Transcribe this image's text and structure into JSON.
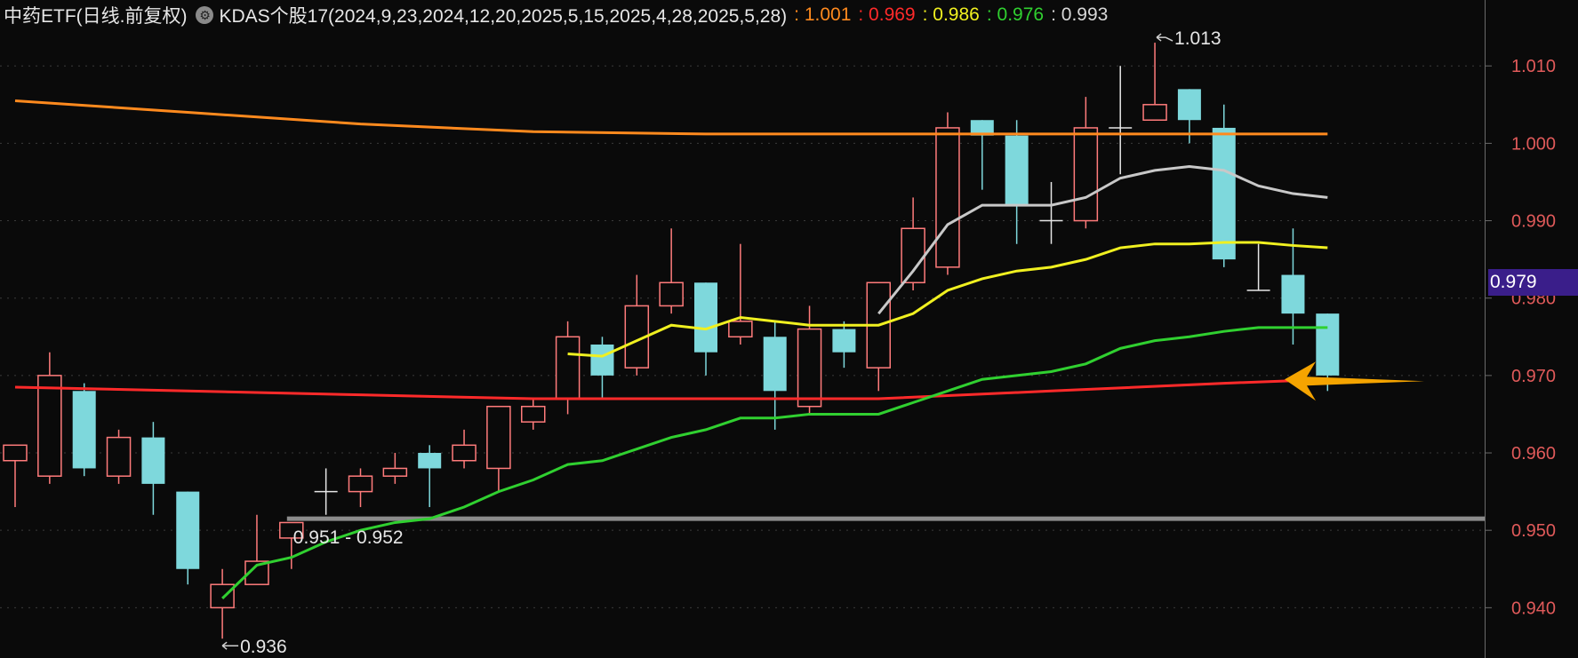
{
  "header": {
    "title": "中药ETF(日线.前复权)",
    "indicator": "KDAS个股17(2024,9,23,2024,12,20,2025,5,15,2025,4,28,2025,5,28)",
    "values": [
      {
        "text": ": 1.001",
        "color": "#ff8a1e"
      },
      {
        "text": ": 0.969",
        "color": "#ff2a2a"
      },
      {
        "text": ": 0.986",
        "color": "#f0f020"
      },
      {
        "text": ": 0.976",
        "color": "#30d030"
      },
      {
        "text": ": 0.993",
        "color": "#d8d8d8"
      }
    ]
  },
  "last_price": "0.979",
  "annotations": {
    "high_label": "1.013",
    "low_label": "0.936",
    "range_label": "0.951 - 0.952"
  },
  "colors": {
    "up": "#ff7b7b",
    "down": "#7ed8dc",
    "doji": "#e6e6e6",
    "arrow": "#f5a400",
    "level_line": "#8c8c8c"
  },
  "chart_data": {
    "type": "candlestick",
    "ylim": [
      0.9335,
      1.0145
    ],
    "ticks": [
      "1.010",
      "1.000",
      "0.990",
      "0.980",
      "0.970",
      "0.960",
      "0.950",
      "0.940"
    ],
    "tick_values": [
      1.01,
      1.0,
      0.99,
      0.98,
      0.97,
      0.96,
      0.95,
      0.94
    ],
    "grid": true,
    "candles": [
      {
        "o": 0.959,
        "h": 0.961,
        "l": 0.953,
        "c": 0.961
      },
      {
        "o": 0.957,
        "h": 0.973,
        "l": 0.956,
        "c": 0.97
      },
      {
        "o": 0.968,
        "h": 0.969,
        "l": 0.957,
        "c": 0.958
      },
      {
        "o": 0.957,
        "h": 0.963,
        "l": 0.956,
        "c": 0.962
      },
      {
        "o": 0.962,
        "h": 0.964,
        "l": 0.952,
        "c": 0.956
      },
      {
        "o": 0.955,
        "h": 0.955,
        "l": 0.943,
        "c": 0.945
      },
      {
        "o": 0.94,
        "h": 0.945,
        "l": 0.936,
        "c": 0.943
      },
      {
        "o": 0.943,
        "h": 0.952,
        "l": 0.943,
        "c": 0.946
      },
      {
        "o": 0.949,
        "h": 0.951,
        "l": 0.945,
        "c": 0.951
      },
      {
        "o": 0.955,
        "h": 0.958,
        "l": 0.952,
        "c": 0.955
      },
      {
        "o": 0.955,
        "h": 0.958,
        "l": 0.953,
        "c": 0.957
      },
      {
        "o": 0.957,
        "h": 0.96,
        "l": 0.956,
        "c": 0.958
      },
      {
        "o": 0.96,
        "h": 0.961,
        "l": 0.953,
        "c": 0.958
      },
      {
        "o": 0.959,
        "h": 0.963,
        "l": 0.958,
        "c": 0.961
      },
      {
        "o": 0.958,
        "h": 0.966,
        "l": 0.955,
        "c": 0.966
      },
      {
        "o": 0.964,
        "h": 0.967,
        "l": 0.963,
        "c": 0.966
      },
      {
        "o": 0.967,
        "h": 0.977,
        "l": 0.965,
        "c": 0.975
      },
      {
        "o": 0.974,
        "h": 0.975,
        "l": 0.967,
        "c": 0.97
      },
      {
        "o": 0.971,
        "h": 0.983,
        "l": 0.97,
        "c": 0.979
      },
      {
        "o": 0.979,
        "h": 0.989,
        "l": 0.978,
        "c": 0.982
      },
      {
        "o": 0.982,
        "h": 0.982,
        "l": 0.97,
        "c": 0.973
      },
      {
        "o": 0.975,
        "h": 0.987,
        "l": 0.974,
        "c": 0.977
      },
      {
        "o": 0.975,
        "h": 0.977,
        "l": 0.963,
        "c": 0.968
      },
      {
        "o": 0.966,
        "h": 0.979,
        "l": 0.965,
        "c": 0.976
      },
      {
        "o": 0.976,
        "h": 0.977,
        "l": 0.971,
        "c": 0.973
      },
      {
        "o": 0.971,
        "h": 0.982,
        "l": 0.968,
        "c": 0.982
      },
      {
        "o": 0.982,
        "h": 0.993,
        "l": 0.981,
        "c": 0.989
      },
      {
        "o": 0.984,
        "h": 1.004,
        "l": 0.983,
        "c": 1.002
      },
      {
        "o": 1.003,
        "h": 1.003,
        "l": 0.994,
        "c": 1.001
      },
      {
        "o": 1.001,
        "h": 1.003,
        "l": 0.987,
        "c": 0.992
      },
      {
        "o": 0.99,
        "h": 0.995,
        "l": 0.987,
        "c": 0.99
      },
      {
        "o": 0.99,
        "h": 1.006,
        "l": 0.989,
        "c": 1.002
      },
      {
        "o": 1.002,
        "h": 1.01,
        "l": 0.996,
        "c": 1.002
      },
      {
        "o": 1.003,
        "h": 1.013,
        "l": 1.003,
        "c": 1.005
      },
      {
        "o": 1.007,
        "h": 1.007,
        "l": 1.0,
        "c": 1.003
      },
      {
        "o": 1.002,
        "h": 1.005,
        "l": 0.984,
        "c": 0.985
      },
      {
        "o": 0.981,
        "h": 0.987,
        "l": 0.981,
        "c": 0.981
      },
      {
        "o": 0.983,
        "h": 0.989,
        "l": 0.974,
        "c": 0.978
      },
      {
        "o": 0.978,
        "h": 0.978,
        "l": 0.968,
        "c": 0.97
      }
    ],
    "series": [
      {
        "color": "#ff8a1e",
        "points": [
          [
            0,
            1.0055
          ],
          [
            5,
            1.004
          ],
          [
            10,
            1.0025
          ],
          [
            15,
            1.0015
          ],
          [
            20,
            1.0012
          ],
          [
            25,
            1.0012
          ],
          [
            30,
            1.0012
          ],
          [
            35,
            1.0012
          ],
          [
            38,
            1.0012
          ]
        ]
      },
      {
        "color": "#ff2a2a",
        "points": [
          [
            0,
            0.9685
          ],
          [
            5,
            0.968
          ],
          [
            10,
            0.9675
          ],
          [
            15,
            0.967
          ],
          [
            20,
            0.967
          ],
          [
            25,
            0.967
          ],
          [
            30,
            0.968
          ],
          [
            35,
            0.969
          ],
          [
            38,
            0.9695
          ]
        ]
      },
      {
        "color": "#30d030",
        "points": [
          [
            6,
            0.9412
          ],
          [
            7,
            0.9455
          ],
          [
            8,
            0.9465
          ],
          [
            9,
            0.9485
          ],
          [
            10,
            0.95
          ],
          [
            11,
            0.951
          ],
          [
            12,
            0.9515
          ],
          [
            13,
            0.953
          ],
          [
            14,
            0.955
          ],
          [
            15,
            0.9565
          ],
          [
            16,
            0.9585
          ],
          [
            17,
            0.959
          ],
          [
            18,
            0.9605
          ],
          [
            19,
            0.962
          ],
          [
            20,
            0.963
          ],
          [
            21,
            0.9645
          ],
          [
            22,
            0.9645
          ],
          [
            23,
            0.965
          ],
          [
            24,
            0.965
          ],
          [
            25,
            0.965
          ],
          [
            26,
            0.9665
          ],
          [
            27,
            0.968
          ],
          [
            28,
            0.9695
          ],
          [
            29,
            0.97
          ],
          [
            30,
            0.9705
          ],
          [
            31,
            0.9715
          ],
          [
            32,
            0.9735
          ],
          [
            33,
            0.9745
          ],
          [
            34,
            0.975
          ],
          [
            35,
            0.9757
          ],
          [
            36,
            0.9762
          ],
          [
            37,
            0.9762
          ],
          [
            38,
            0.9762
          ]
        ]
      },
      {
        "color": "#f0f020",
        "points": [
          [
            16,
            0.9728
          ],
          [
            17,
            0.9725
          ],
          [
            18,
            0.9745
          ],
          [
            19,
            0.9765
          ],
          [
            20,
            0.976
          ],
          [
            21,
            0.9775
          ],
          [
            22,
            0.977
          ],
          [
            23,
            0.9765
          ],
          [
            24,
            0.9765
          ],
          [
            25,
            0.9765
          ],
          [
            26,
            0.978
          ],
          [
            27,
            0.981
          ],
          [
            28,
            0.9825
          ],
          [
            29,
            0.9835
          ],
          [
            30,
            0.984
          ],
          [
            31,
            0.985
          ],
          [
            32,
            0.9865
          ],
          [
            33,
            0.987
          ],
          [
            34,
            0.987
          ],
          [
            35,
            0.9872
          ],
          [
            36,
            0.9872
          ],
          [
            37,
            0.9868
          ],
          [
            38,
            0.9865
          ]
        ]
      },
      {
        "color": "#c8c8c8",
        "points": [
          [
            25,
            0.978
          ],
          [
            26,
            0.9835
          ],
          [
            27,
            0.9895
          ],
          [
            28,
            0.992
          ],
          [
            29,
            0.992
          ],
          [
            30,
            0.992
          ],
          [
            31,
            0.993
          ],
          [
            32,
            0.9955
          ],
          [
            33,
            0.9965
          ],
          [
            34,
            0.997
          ],
          [
            35,
            0.9965
          ],
          [
            36,
            0.9945
          ],
          [
            37,
            0.9935
          ],
          [
            38,
            0.993
          ]
        ]
      }
    ],
    "level_line": {
      "value": 0.9515,
      "from_index": 8
    }
  }
}
